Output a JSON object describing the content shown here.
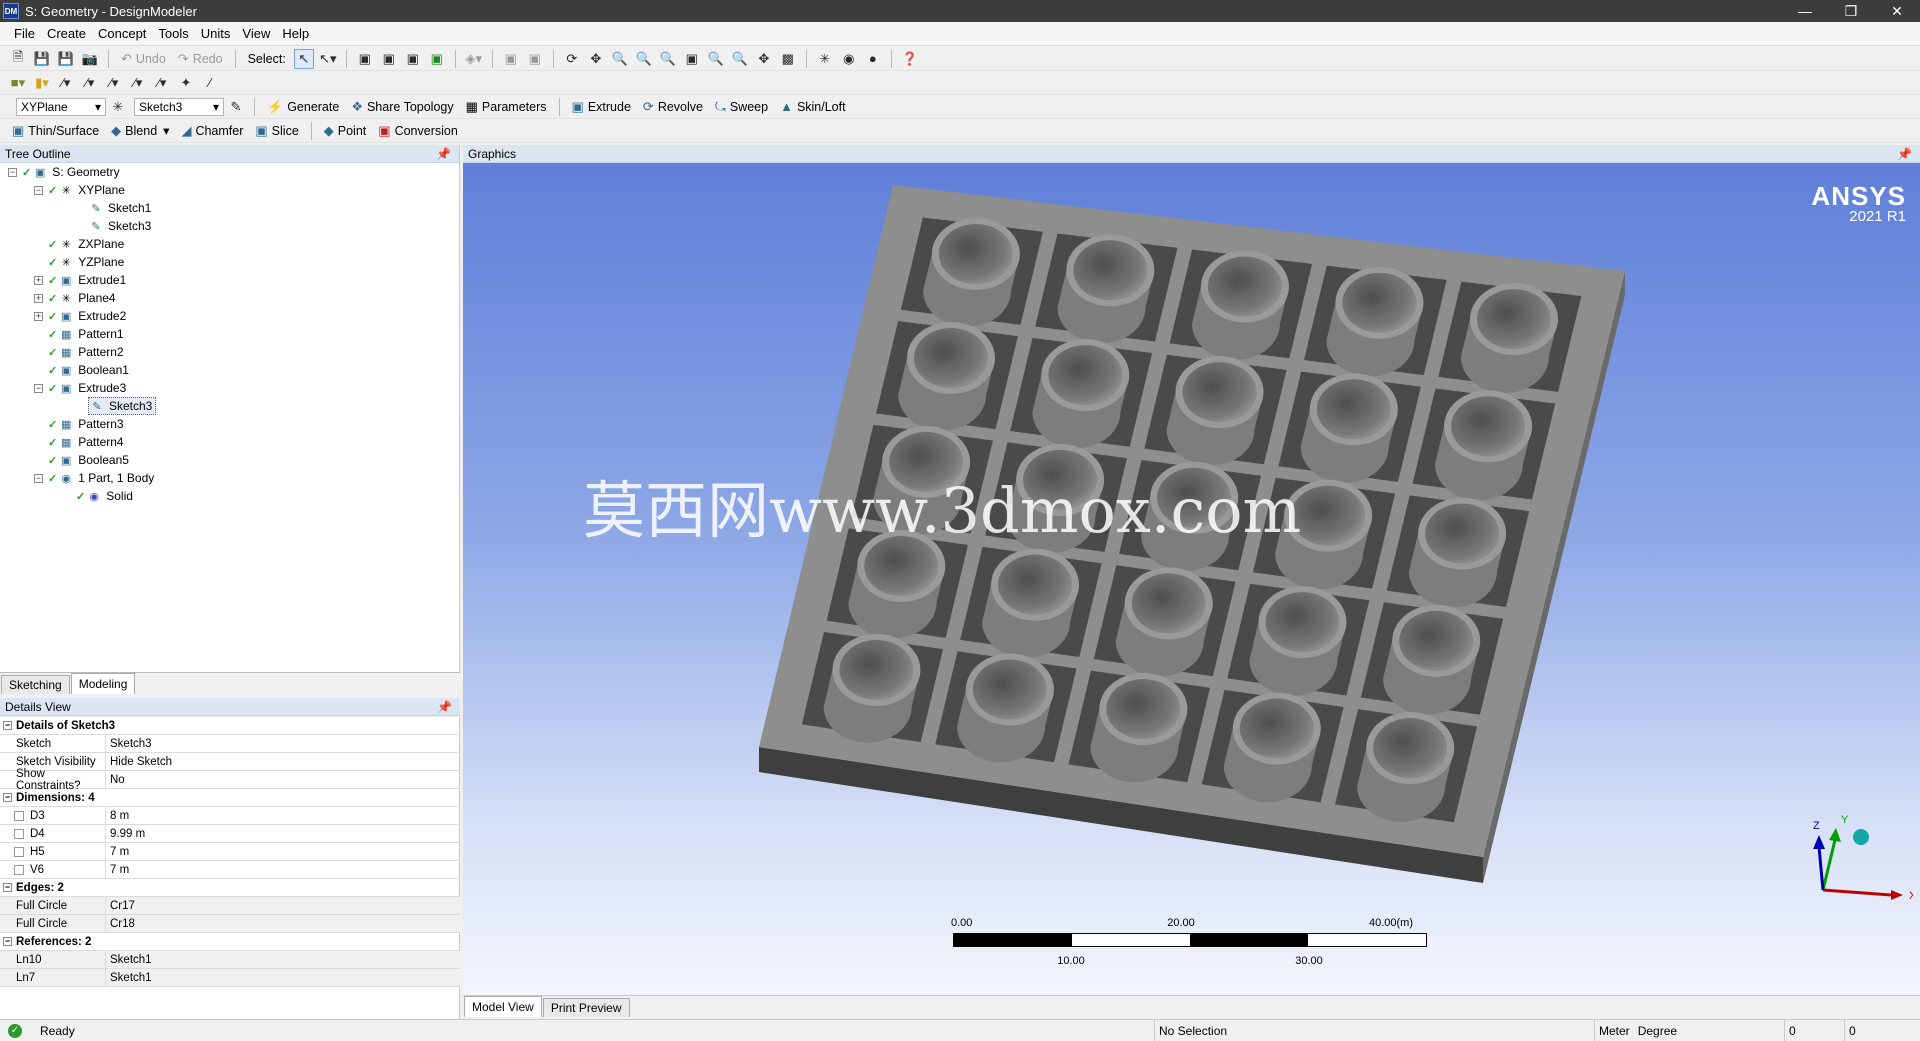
{
  "app": {
    "title": "S: Geometry - DesignModeler",
    "logo": "DM"
  },
  "menu": [
    "File",
    "Create",
    "Concept",
    "Tools",
    "Units",
    "View",
    "Help"
  ],
  "toolbar1": {
    "undo": "Undo",
    "redo": "Redo",
    "select": "Select:"
  },
  "toolbar3": {
    "plane": "XYPlane",
    "sketch": "Sketch3",
    "generate": "Generate",
    "share_topology": "Share Topology",
    "parameters": "Parameters",
    "extrude": "Extrude",
    "revolve": "Revolve",
    "sweep": "Sweep",
    "skin_loft": "Skin/Loft"
  },
  "toolbar4": {
    "thin_surface": "Thin/Surface",
    "blend": "Blend",
    "chamfer": "Chamfer",
    "slice": "Slice",
    "point": "Point",
    "conversion": "Conversion"
  },
  "tree": {
    "header": "Tree Outline",
    "items": [
      {
        "label": "S: Geometry"
      },
      {
        "label": "XYPlane"
      },
      {
        "label": "Sketch1"
      },
      {
        "label": "Sketch3"
      },
      {
        "label": "ZXPlane"
      },
      {
        "label": "YZPlane"
      },
      {
        "label": "Extrude1"
      },
      {
        "label": "Plane4"
      },
      {
        "label": "Extrude2"
      },
      {
        "label": "Pattern1"
      },
      {
        "label": "Pattern2"
      },
      {
        "label": "Boolean1"
      },
      {
        "label": "Extrude3"
      },
      {
        "label": "Sketch3"
      },
      {
        "label": "Pattern3"
      },
      {
        "label": "Pattern4"
      },
      {
        "label": "Boolean5"
      },
      {
        "label": "1 Part, 1 Body"
      },
      {
        "label": "Solid"
      }
    ]
  },
  "left_tabs": [
    "Sketching",
    "Modeling"
  ],
  "details": {
    "header": "Details View",
    "groups": [
      {
        "title": "Details of Sketch3",
        "rows": [
          [
            "Sketch",
            "Sketch3"
          ],
          [
            "Sketch Visibility",
            "Hide Sketch"
          ],
          [
            "Show Constraints?",
            "No"
          ]
        ]
      },
      {
        "title": "Dimensions: 4",
        "rows": [
          [
            "D3",
            "8 m"
          ],
          [
            "D4",
            "9.99 m"
          ],
          [
            "H5",
            "7 m"
          ],
          [
            "V6",
            "7 m"
          ]
        ]
      },
      {
        "title": "Edges: 2",
        "rows": [
          [
            "Full Circle",
            "Cr17"
          ],
          [
            "Full Circle",
            "Cr18"
          ]
        ]
      },
      {
        "title": "References: 2",
        "rows": [
          [
            "Ln10",
            "Sketch1"
          ],
          [
            "Ln7",
            "Sketch1"
          ]
        ]
      }
    ]
  },
  "graphics": {
    "header": "Graphics",
    "brand": "ANSYS",
    "version": "2021 R1",
    "watermark": "莫西网www.3dmox.com",
    "scale": {
      "top_labels": [
        "0.00",
        "20.00",
        "40.00"
      ],
      "bottom_labels": [
        "10.00",
        "30.00"
      ],
      "unit": "(m)"
    },
    "axes": {
      "x": "X",
      "y": "Y",
      "z": "Z"
    },
    "colors": {
      "bg_top": "#5d7ed8",
      "bg_bottom": "#f4f6fc",
      "solid": "#8c8c8c"
    }
  },
  "right_tabs": [
    "Model View",
    "Print Preview"
  ],
  "status": {
    "ready": "Ready",
    "selection": "No Selection",
    "units_length": "Meter",
    "units_angle": "Degree",
    "v1": "0",
    "v2": "0"
  }
}
